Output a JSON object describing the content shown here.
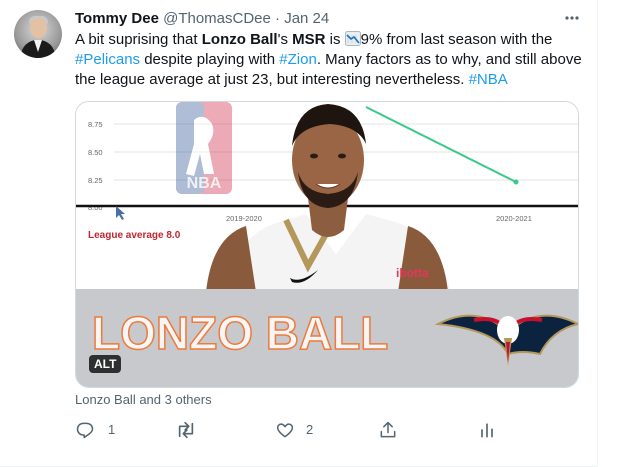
{
  "tweet": {
    "author_name": "Tommy Dee",
    "author_handle": "@ThomasCDee",
    "separator": "·",
    "date": "Jan 24",
    "text_parts": {
      "p1": "A bit suprising that ",
      "p2": "Lonzo Ball",
      "p3": "'s ",
      "p4": "MSR",
      "p5": " is ",
      "p6": "9% from last season with the ",
      "p7": "#Pelicans",
      "p8": " despite playing with ",
      "p9": "#Zion",
      "p10": ".  Many factors as to why, and still above the league average at just 23, but interesting nevertheless.  ",
      "p11": "#NBA"
    },
    "emoji": "chart-decreasing-icon"
  },
  "media": {
    "chart": {
      "y_ticks": [
        "8.75",
        "8.50",
        "8.25",
        "8.00"
      ],
      "x_ticks": [
        "2019-2020",
        "2020-2021"
      ],
      "league_label": "League average 8.0",
      "logo_text": "NBA"
    },
    "jersey_sponsor": "ibotta",
    "banner_text": "LONZO BALL",
    "alt_label": "ALT"
  },
  "likers": "Lonzo Ball and 3 others",
  "actions": {
    "reply_count": "1",
    "retweet_count": "",
    "like_count": "2"
  },
  "colors": {
    "link": "#1d9bf0",
    "muted": "#536471",
    "trend_line": "#3cc78d",
    "banner_bg": "#c7c9cd",
    "banner_text": "#f6f6f6",
    "banner_outline": "#f07a3a"
  }
}
